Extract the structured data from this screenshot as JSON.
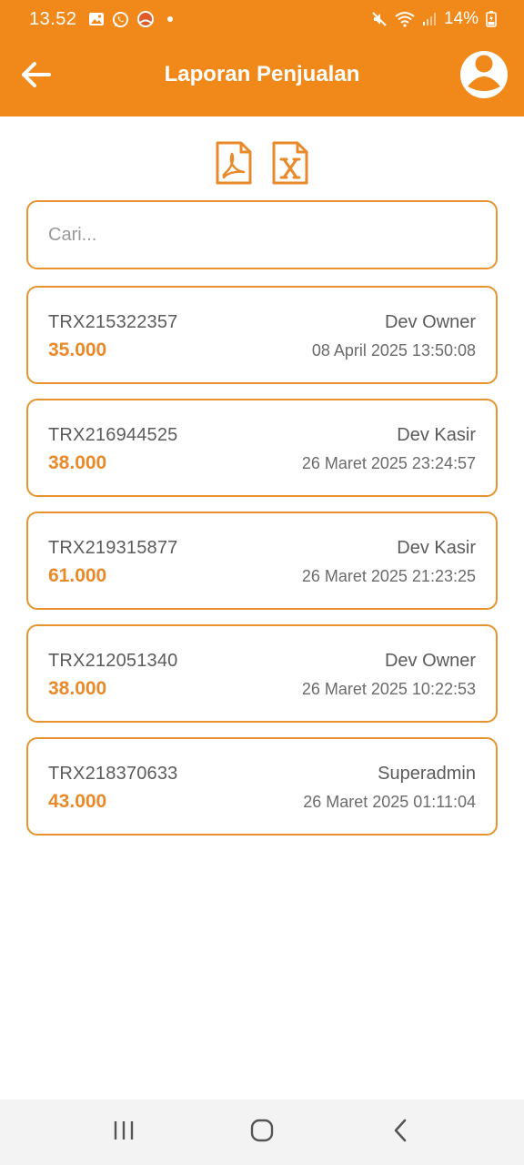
{
  "status_bar": {
    "time": "13.52",
    "battery": "14%",
    "icons": [
      "image-icon",
      "whatsapp-icon",
      "app-notification-icon",
      "mute-icon",
      "wifi-icon",
      "signal-icon",
      "battery-charging-icon"
    ]
  },
  "app_bar": {
    "title": "Laporan Penjualan",
    "back_icon": "arrow-left-icon",
    "profile_icon": "user-avatar-icon"
  },
  "export": {
    "pdf_icon": "pdf-file-icon",
    "excel_icon": "excel-file-icon"
  },
  "search": {
    "placeholder": "Cari...",
    "value": ""
  },
  "transactions": [
    {
      "id": "TRX215322357",
      "amount": "35.000",
      "user": "Dev Owner",
      "date": "08 April 2025 13:50:08"
    },
    {
      "id": "TRX216944525",
      "amount": "38.000",
      "user": "Dev Kasir",
      "date": "26 Maret 2025 23:24:57"
    },
    {
      "id": "TRX219315877",
      "amount": "61.000",
      "user": "Dev Kasir",
      "date": "26 Maret 2025 21:23:25"
    },
    {
      "id": "TRX212051340",
      "amount": "38.000",
      "user": "Dev Owner",
      "date": "26 Maret 2025 10:22:53"
    },
    {
      "id": "TRX218370633",
      "amount": "43.000",
      "user": "Superadmin",
      "date": "26 Maret 2025 01:11:04"
    }
  ],
  "nav_bar": {
    "icons": [
      "recent-apps-icon",
      "home-icon",
      "back-nav-icon"
    ]
  },
  "colors": {
    "primary": "#F0891A",
    "accent": "#E8932E",
    "amount": "#E8892A"
  }
}
